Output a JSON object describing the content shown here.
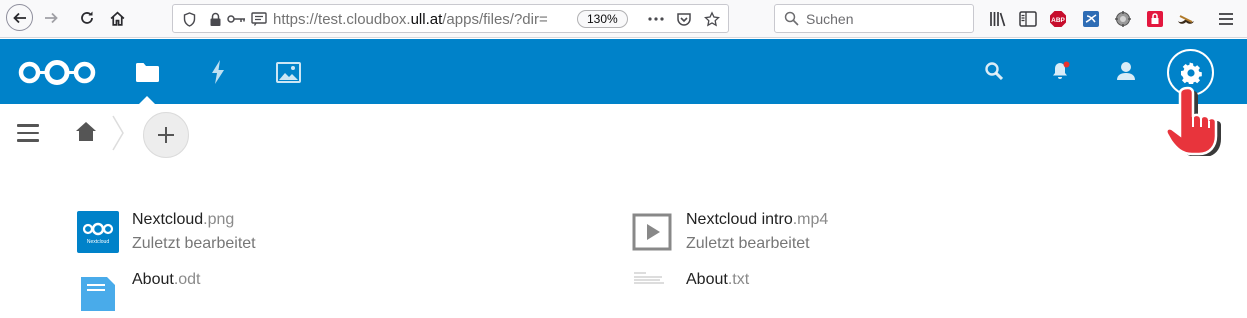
{
  "browser": {
    "url_prefix": "https://test.cloudbox.",
    "url_domain": "ull.at",
    "url_rest": "/apps/files/?dir=",
    "zoom": "130%",
    "search_placeholder": "Suchen",
    "abp_label": "ABP"
  },
  "nextcloud": {
    "brand_color": "#0082c9",
    "apps": [
      "files",
      "activity",
      "gallery"
    ],
    "active_app": "files"
  },
  "files": [
    {
      "name": "Nextcloud",
      "ext": ".png",
      "subtitle": "Zuletzt bearbeitet",
      "thumb_text": "Nextcloud"
    },
    {
      "name": "Nextcloud intro",
      "ext": ".mp4",
      "subtitle": "Zuletzt bearbeitet"
    },
    {
      "name": "About",
      "ext": ".odt",
      "subtitle": ""
    },
    {
      "name": "About",
      "ext": ".txt",
      "subtitle": ""
    }
  ]
}
